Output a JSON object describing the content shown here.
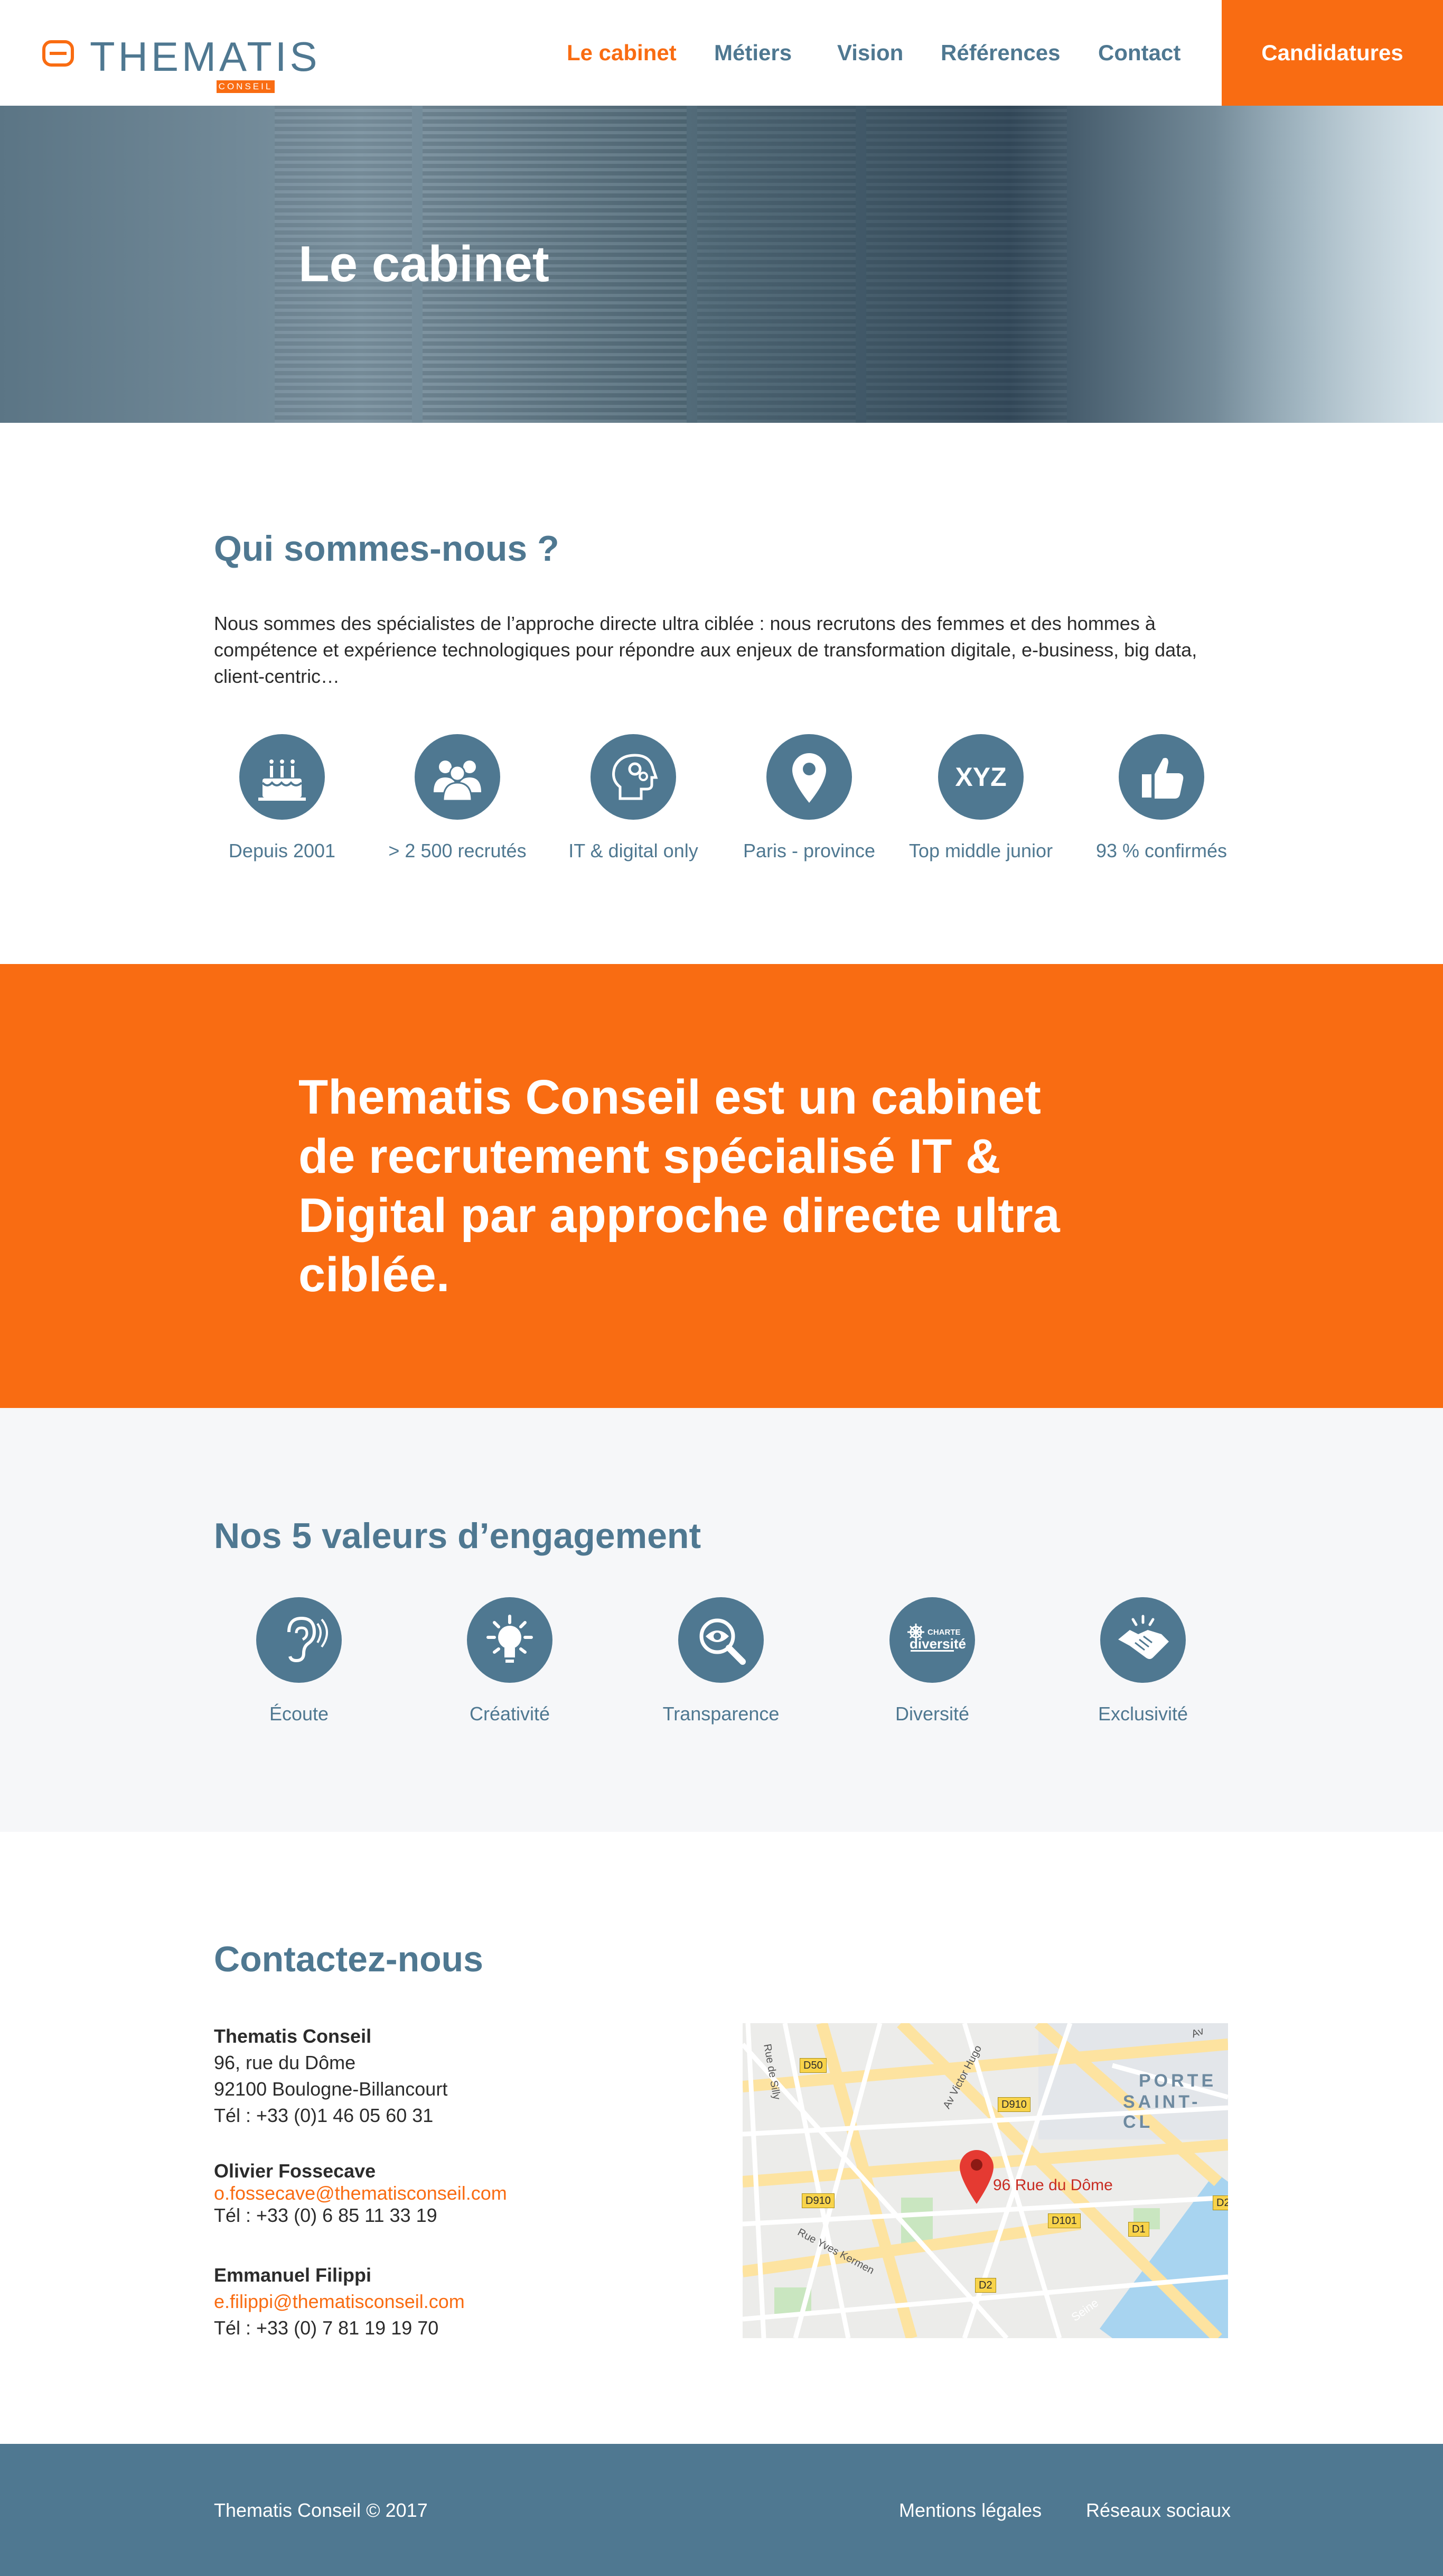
{
  "header": {
    "logo_text": "THEMATIS",
    "logo_sub": "CONSEIL",
    "nav": [
      "Le cabinet",
      "Métiers",
      "Vision",
      "Références",
      "Contact"
    ],
    "cta": "Candidatures"
  },
  "hero": {
    "title": "Le cabinet"
  },
  "about": {
    "title": "Qui sommes-nous ?",
    "text": "Nous sommes des spécialistes de l’approche directe ultra ciblée : nous recrutons des femmes et des hommes à compétence et expérience technologiques pour répondre aux enjeux de transformation digitale, e-business, big data, client-centric…",
    "stats": [
      {
        "icon": "cake-icon",
        "label": "Depuis 2001"
      },
      {
        "icon": "people-icon",
        "label": "> 2 500 recrutés"
      },
      {
        "icon": "brain-gears-icon",
        "label": "IT & digital only"
      },
      {
        "icon": "map-pin-icon",
        "label": "Paris - province"
      },
      {
        "icon": "xyz-icon",
        "icon_text": "XYZ",
        "label": "Top middle junior"
      },
      {
        "icon": "thumbs-up-icon",
        "label": "93 % confirmés"
      }
    ]
  },
  "band": {
    "text": "Thematis Conseil est un cabinet de recrutement spécialisé IT & Digital par approche directe ultra ciblée."
  },
  "values": {
    "title": "Nos 5 valeurs d’engagement",
    "items": [
      {
        "icon": "ear-icon",
        "label": "Écoute"
      },
      {
        "icon": "lightbulb-icon",
        "label": "Créativité"
      },
      {
        "icon": "eye-magnifier-icon",
        "label": "Transparence"
      },
      {
        "icon": "diversity-charter-icon",
        "label": "Diversité",
        "badge_line1": "CHARTE",
        "badge_line2": "diversité"
      },
      {
        "icon": "handshake-icon",
        "label": "Exclusivité"
      }
    ]
  },
  "contact": {
    "title": "Contactez-nous",
    "company": {
      "name": "Thematis Conseil",
      "address1": "96, rue du Dôme",
      "address2": "92100 Boulogne-Billancourt",
      "phone": "Tél : +33 (0)1 46 05 60 31"
    },
    "people": [
      {
        "name": "Olivier Fossecave",
        "email": "o.fossecave@thematisconseil.com",
        "phone": "Tél : +33 (0) 6 85 11 33 19"
      },
      {
        "name": "Emmanuel Filippi",
        "email": "e.filippi@thematisconseil.com",
        "phone": "Tél : +33 (0) 7 81 19 19 70"
      }
    ],
    "map": {
      "pin_label": "96 Rue du Dôme",
      "district": "PORTE",
      "district2": "SAINT-CL",
      "road_labels": [
        "D50",
        "D910",
        "D910",
        "D101",
        "D1",
        "D2",
        "D2"
      ],
      "street_labels": [
        "Rue de Silly",
        "Av Victor Hugo",
        "Rue Yves Kermen",
        "Seine",
        "Av"
      ]
    }
  },
  "footer": {
    "copyright": "Thematis Conseil © 2017",
    "links": [
      "Mentions légales",
      "Réseaux sociaux"
    ]
  },
  "colors": {
    "accent": "#f96c12",
    "brand": "#4f7891",
    "light_bg": "#f6f7f9"
  }
}
